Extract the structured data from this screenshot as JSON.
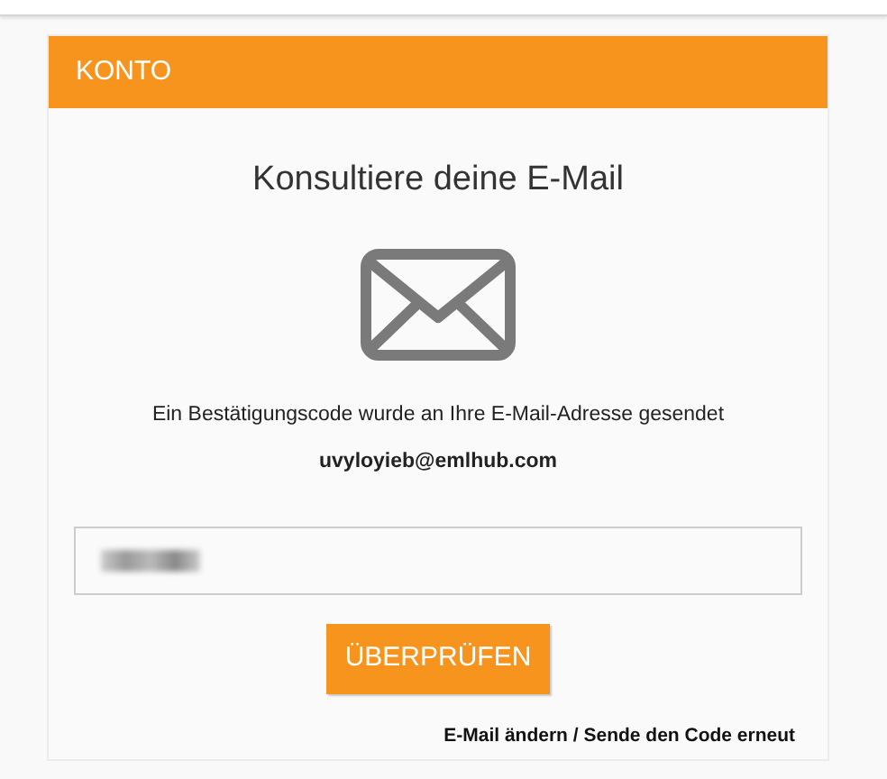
{
  "panel": {
    "title": "KONTO"
  },
  "heading": "Konsultiere deine E-Mail",
  "message": "Ein Bestätigungscode wurde an Ihre E-Mail-Adresse gesendet",
  "email": "uvyloyieb@emlhub.com",
  "code_field": {
    "value_blurred": true
  },
  "verify_button": "ÜBERPRÜFEN",
  "links": [
    "E-Mail ändern / Sende den Code erneut"
  ]
}
